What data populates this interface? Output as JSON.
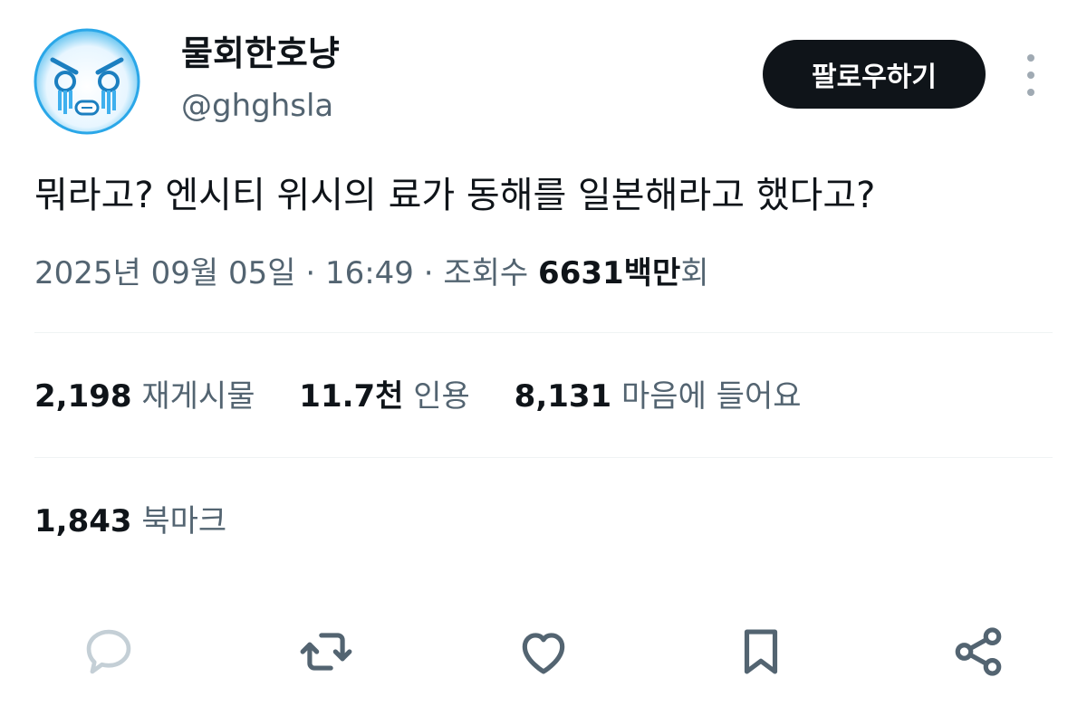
{
  "author": {
    "display_name": "물회한호냥",
    "handle": "@ghghsla",
    "avatar_icon": "crying-face-avatar"
  },
  "header": {
    "follow_label": "팔로우하기",
    "more_icon": "more-vertical-icon"
  },
  "tweet": {
    "text": "뭐라고? 엔시티 위시의 료가 동해를 일본해라고 했다고?"
  },
  "meta": {
    "date": "2025년 09월 05일",
    "separator": "·",
    "time": "16:49",
    "views_label": "조회수",
    "views_value": "6631백만",
    "views_suffix": "회"
  },
  "stats": {
    "retweets_count": "2,198",
    "retweets_label": "재게시물",
    "quotes_count": "11.7천",
    "quotes_label": "인용",
    "likes_count": "8,131",
    "likes_label": "마음에 들어요",
    "bookmarks_count": "1,843",
    "bookmarks_label": "북마크"
  },
  "actions": {
    "icons": [
      "reply-icon",
      "retweet-icon",
      "like-icon",
      "bookmark-icon",
      "share-icon"
    ]
  },
  "colors": {
    "text_primary": "#0f1419",
    "text_secondary": "#536471",
    "button_bg": "#0f1419",
    "avatar_blue": "#1d9bf0",
    "icon_gray": "#536471"
  }
}
